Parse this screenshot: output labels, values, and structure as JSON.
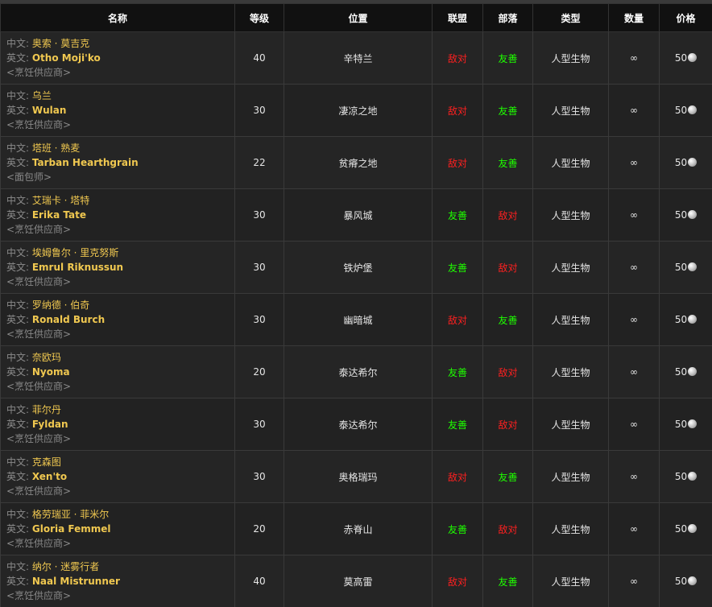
{
  "headers": {
    "name": "名称",
    "level": "等级",
    "location": "位置",
    "alliance": "联盟",
    "horde": "部落",
    "type": "类型",
    "quantity": "数量",
    "price": "价格"
  },
  "labels": {
    "cn": "中文: ",
    "en": "英文: "
  },
  "coin_icon": "silver-coin-icon",
  "colors": {
    "hostile": "#ff2020",
    "friendly": "#1eff00",
    "name": "#f0c850"
  },
  "rows": [
    {
      "cn_name": "奥索 · 莫吉克",
      "en_name": "Otho Moji'ko",
      "role": "<烹饪供应商>",
      "level": "40",
      "location": "辛特兰",
      "alliance": "敌对",
      "horde": "友善",
      "type": "人型生物",
      "quantity": "∞",
      "price": "50"
    },
    {
      "cn_name": "乌兰",
      "en_name": "Wulan",
      "role": "<烹饪供应商>",
      "level": "30",
      "location": "凄凉之地",
      "alliance": "敌对",
      "horde": "友善",
      "type": "人型生物",
      "quantity": "∞",
      "price": "50"
    },
    {
      "cn_name": "塔班 · 熟麦",
      "en_name": "Tarban Hearthgrain",
      "role": "<面包师>",
      "level": "22",
      "location": "贫瘠之地",
      "alliance": "敌对",
      "horde": "友善",
      "type": "人型生物",
      "quantity": "∞",
      "price": "50"
    },
    {
      "cn_name": "艾瑞卡 · 塔特",
      "en_name": "Erika Tate",
      "role": "<烹饪供应商>",
      "level": "30",
      "location": "暴风城",
      "alliance": "友善",
      "horde": "敌对",
      "type": "人型生物",
      "quantity": "∞",
      "price": "50"
    },
    {
      "cn_name": "埃姆鲁尔 · 里克努斯",
      "en_name": "Emrul Riknussun",
      "role": "<烹饪供应商>",
      "level": "30",
      "location": "铁炉堡",
      "alliance": "友善",
      "horde": "敌对",
      "type": "人型生物",
      "quantity": "∞",
      "price": "50"
    },
    {
      "cn_name": "罗纳德 · 伯奇",
      "en_name": "Ronald Burch",
      "role": "<烹饪供应商>",
      "level": "30",
      "location": "幽暗城",
      "alliance": "敌对",
      "horde": "友善",
      "type": "人型生物",
      "quantity": "∞",
      "price": "50"
    },
    {
      "cn_name": "奈欧玛",
      "en_name": "Nyoma",
      "role": "<烹饪供应商>",
      "level": "20",
      "location": "泰达希尔",
      "alliance": "友善",
      "horde": "敌对",
      "type": "人型生物",
      "quantity": "∞",
      "price": "50"
    },
    {
      "cn_name": "菲尔丹",
      "en_name": "Fyldan",
      "role": "<烹饪供应商>",
      "level": "30",
      "location": "泰达希尔",
      "alliance": "友善",
      "horde": "敌对",
      "type": "人型生物",
      "quantity": "∞",
      "price": "50"
    },
    {
      "cn_name": "克森图",
      "en_name": "Xen'to",
      "role": "<烹饪供应商>",
      "level": "30",
      "location": "奥格瑞玛",
      "alliance": "敌对",
      "horde": "友善",
      "type": "人型生物",
      "quantity": "∞",
      "price": "50"
    },
    {
      "cn_name": "格劳瑞亚 · 菲米尔",
      "en_name": "Gloria Femmel",
      "role": "<烹饪供应商>",
      "level": "20",
      "location": "赤脊山",
      "alliance": "友善",
      "horde": "敌对",
      "type": "人型生物",
      "quantity": "∞",
      "price": "50"
    },
    {
      "cn_name": "纳尔 · 迷雾行者",
      "en_name": "Naal Mistrunner",
      "role": "<烹饪供应商>",
      "level": "40",
      "location": "莫高雷",
      "alliance": "敌对",
      "horde": "友善",
      "type": "人型生物",
      "quantity": "∞",
      "price": "50"
    }
  ]
}
